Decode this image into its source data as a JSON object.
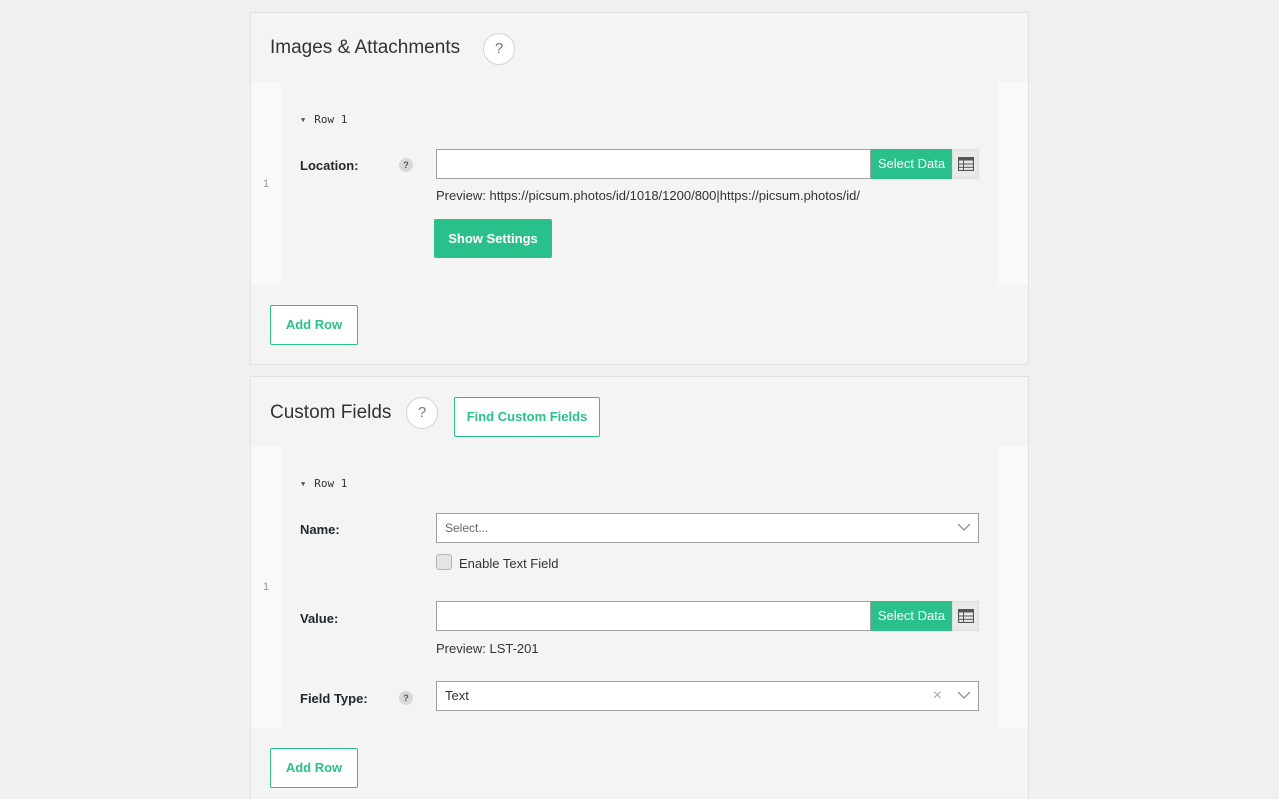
{
  "images_panel": {
    "title": "Images & Attachments",
    "help": "?",
    "row_toggle": "Row 1",
    "row_number": "1",
    "location": {
      "label": "Location:",
      "help": "?",
      "value": "",
      "select_data": "Select Data",
      "preview": "Preview: https://picsum.photos/id/1018/1200/800|https://picsum.photos/id/"
    },
    "show_settings": "Show Settings",
    "add_row": "Add Row"
  },
  "custom_fields_panel": {
    "title": "Custom Fields",
    "help": "?",
    "find_button": "Find Custom Fields",
    "row_toggle": "Row 1",
    "row_number": "1",
    "name": {
      "label": "Name:",
      "placeholder": "Select...",
      "enable_text_field": "Enable Text Field"
    },
    "value": {
      "label": "Value:",
      "value": "",
      "select_data": "Select Data",
      "preview": "Preview: LST-201"
    },
    "field_type": {
      "label": "Field Type:",
      "help": "?",
      "selected": "Text",
      "clear": "×"
    },
    "add_row": "Add Row"
  },
  "colors": {
    "accent": "#29c08a",
    "background": "#f0f0f0",
    "panel": "#f4f4f4"
  }
}
